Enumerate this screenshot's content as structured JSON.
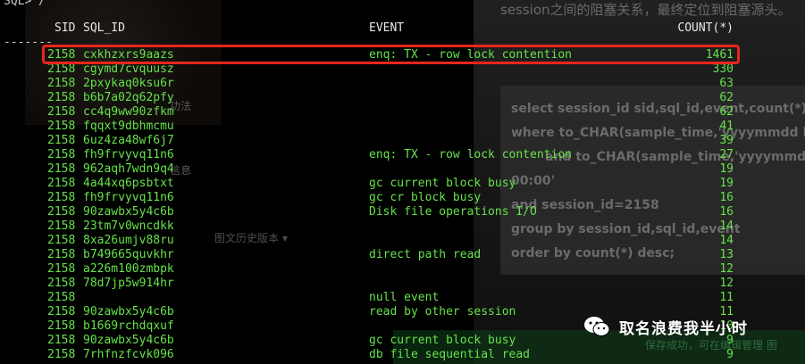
{
  "terminal": {
    "prompt": "SQL> /",
    "separator": "-------",
    "headers": {
      "sid": "SID",
      "sql_id": "SQL_ID",
      "event": "EVENT",
      "count": "COUNT(*)"
    },
    "rows": [
      {
        "sid": "2158",
        "sql_id": "cxkhzxrs9aazs",
        "event": "enq: TX - row lock contention",
        "count": "1461"
      },
      {
        "sid": "2158",
        "sql_id": "cgymd7cvquusz",
        "event": "",
        "count": "330"
      },
      {
        "sid": "2158",
        "sql_id": "2pxykaq0ksu6r",
        "event": "",
        "count": "63"
      },
      {
        "sid": "2158",
        "sql_id": "b6b7a02q62pfy",
        "event": "",
        "count": "62"
      },
      {
        "sid": "2158",
        "sql_id": "cc4q9ww90zfkm",
        "event": "",
        "count": "62"
      },
      {
        "sid": "2158",
        "sql_id": "fqqxt9dbhmcmu",
        "event": "",
        "count": "41"
      },
      {
        "sid": "2158",
        "sql_id": "6uz4za48wf6j7",
        "event": "",
        "count": "39"
      },
      {
        "sid": "2158",
        "sql_id": "fh9frvyvq11n6",
        "event": "enq: TX - row lock contention",
        "count": "27"
      },
      {
        "sid": "2158",
        "sql_id": "962aqh7wdn9q4",
        "event": "",
        "count": "19"
      },
      {
        "sid": "2158",
        "sql_id": "4a44xq6psbtxt",
        "event": "gc current block busy",
        "count": "19"
      },
      {
        "sid": "2158",
        "sql_id": "fh9frvyvq11n6",
        "event": "gc cr block busy",
        "count": "16"
      },
      {
        "sid": "2158",
        "sql_id": "90zawbx5y4c6b",
        "event": "Disk file operations I/O",
        "count": "16"
      },
      {
        "sid": "2158",
        "sql_id": "23tm7v0wncdkk",
        "event": "",
        "count": "14"
      },
      {
        "sid": "2158",
        "sql_id": "8xa26umjv88ru",
        "event": "",
        "count": "14"
      },
      {
        "sid": "2158",
        "sql_id": "b749665quvkhr",
        "event": "direct path read",
        "count": "13"
      },
      {
        "sid": "2158",
        "sql_id": "a226m100zmbpk",
        "event": "",
        "count": "12"
      },
      {
        "sid": "2158",
        "sql_id": "78d7jp5w914hr",
        "event": "",
        "count": "12"
      },
      {
        "sid": "2158",
        "sql_id": "",
        "event": "null event",
        "count": "11"
      },
      {
        "sid": "2158",
        "sql_id": "90zawbx5y4c6b",
        "event": "read by other session",
        "count": "11"
      },
      {
        "sid": "2158",
        "sql_id": "b1669rchdqxuf",
        "event": "",
        "count": "10"
      },
      {
        "sid": "2158",
        "sql_id": "90zawbx5y4c6b",
        "event": "gc current block busy",
        "count": "9"
      },
      {
        "sid": "2158",
        "sql_id": "7rhfnzfcvk096",
        "event": "db file sequential read",
        "count": "9"
      }
    ]
  },
  "background": {
    "header_text": "session之间的阻塞关系，最终定位到阻塞源头。",
    "code_lines": [
      "select session_id sid,sql_id,event,count(*) fr",
      "where to_CHAR(sample_time,'yyyymmdd h",
      "and to_CHAR(sample_time,'yyyymmdd",
      "00:00'",
      "and session_id=2158",
      "group by session_id,sql_id,event",
      "order by count(*) desc;"
    ],
    "ghost_left_1": "功法",
    "ghost_left_2": "信息",
    "ghost_left_3": "图文历史版本 ▾",
    "save_text": "保存成功，可在编辑管理 图"
  },
  "watermark": {
    "text": "取名浪费我半小时",
    "icon": "wechat-icon"
  },
  "colors": {
    "terminal_text": "#66e34a",
    "highlight_border": "#e8261c"
  }
}
